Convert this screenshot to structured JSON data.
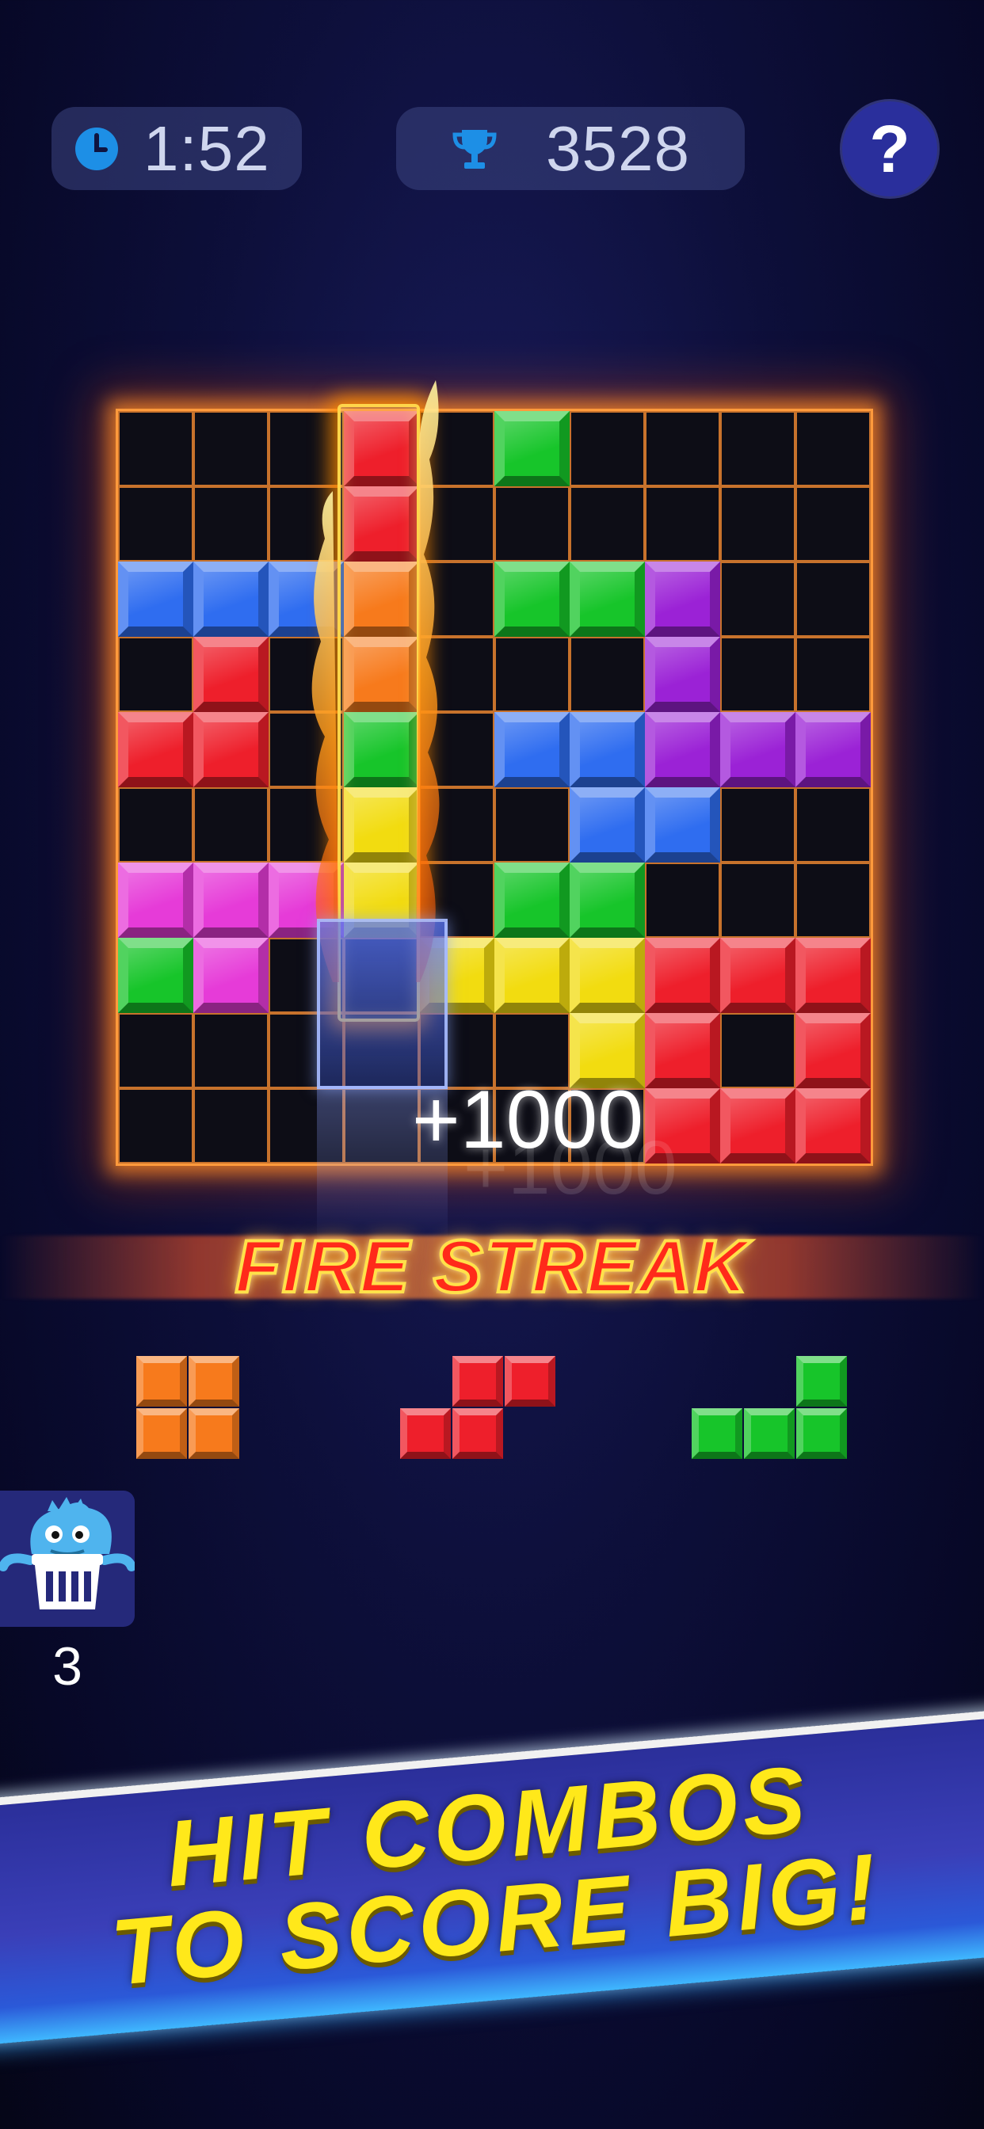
{
  "hud": {
    "timer": "1:52",
    "timer_icon": "clock-icon",
    "score": "3528",
    "score_icon": "trophy-icon",
    "help_label": "?"
  },
  "board": {
    "rows": 10,
    "cols": 10,
    "cells": [
      [
        null,
        null,
        null,
        "red",
        null,
        "green",
        null,
        null,
        null,
        null
      ],
      [
        null,
        null,
        null,
        "red",
        null,
        null,
        null,
        null,
        null,
        null
      ],
      [
        "blue",
        "blue",
        "blue",
        "orange",
        null,
        "green",
        "green",
        "purple",
        null,
        null
      ],
      [
        null,
        "red",
        null,
        "orange",
        null,
        null,
        null,
        "purple",
        null,
        null
      ],
      [
        "red",
        "red",
        null,
        "green",
        null,
        "blue",
        "blue",
        "purple",
        "purple",
        "purple"
      ],
      [
        null,
        null,
        null,
        "yellow",
        null,
        null,
        "blue",
        "blue",
        null,
        null
      ],
      [
        "pink",
        "pink",
        "pink",
        "yellow",
        null,
        "green",
        "green",
        null,
        null,
        null
      ],
      [
        "green",
        "pink",
        null,
        null,
        "yellow",
        "yellow",
        "yellow",
        "red",
        "red",
        "red"
      ],
      [
        null,
        null,
        null,
        null,
        null,
        null,
        "yellow",
        "red",
        null,
        "red"
      ],
      [
        null,
        null,
        null,
        null,
        null,
        null,
        null,
        "red",
        "red",
        "red"
      ]
    ],
    "burning_column": 3
  },
  "colors": {
    "red": "#ee1f2b",
    "orange": "#f77a1c",
    "yellow": "#f2dc10",
    "green": "#17c52a",
    "blue": "#2f6df0",
    "purple": "#9b22d6",
    "pink": "#e63bd8",
    "grid_line": "#c7722c",
    "banner_text": "#ffe81a"
  },
  "points_popup": "+1000",
  "streak_label": "FIRE STREAK",
  "pieces": [
    {
      "color": "orange",
      "blocks": [
        [
          0,
          0
        ],
        [
          1,
          0
        ],
        [
          0,
          1
        ],
        [
          1,
          1
        ]
      ]
    },
    {
      "color": "red",
      "blocks": [
        [
          1,
          0
        ],
        [
          2,
          0
        ],
        [
          0,
          1
        ],
        [
          1,
          1
        ]
      ]
    },
    {
      "color": "green",
      "blocks": [
        [
          2,
          0
        ],
        [
          0,
          1
        ],
        [
          1,
          1
        ],
        [
          2,
          1
        ]
      ]
    }
  ],
  "powerup": {
    "icon": "monster-trash-icon",
    "count": "3"
  },
  "banner": {
    "line1": "HIT COMBOS",
    "line2": "TO SCORE BIG!"
  }
}
